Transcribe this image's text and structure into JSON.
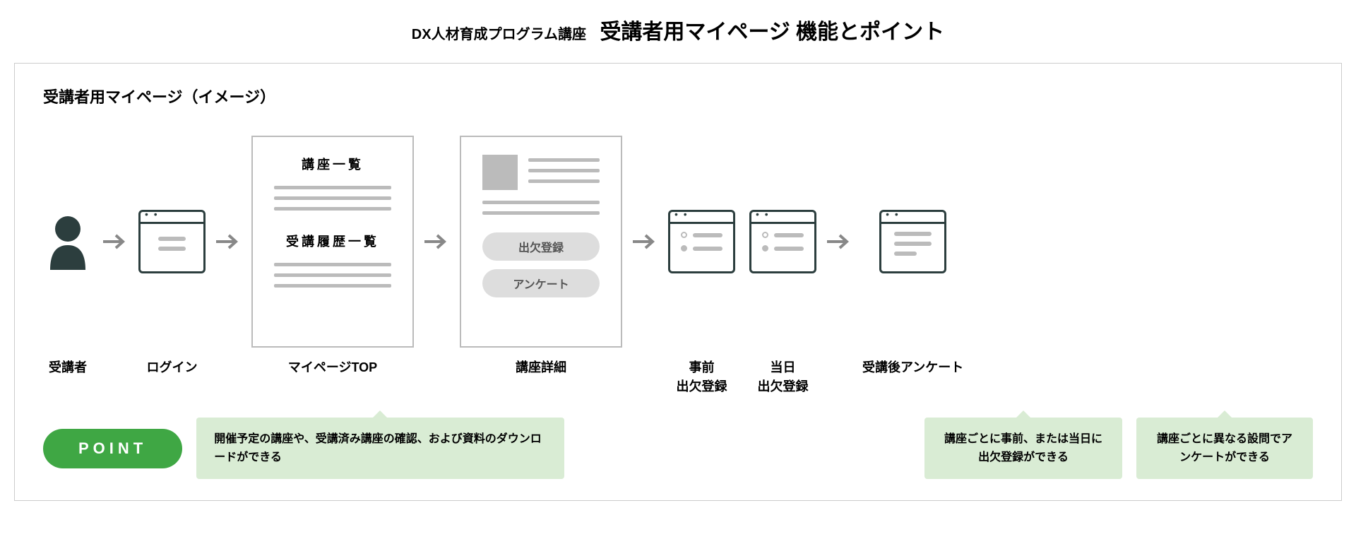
{
  "header": {
    "small": "DX人材育成プログラム講座",
    "large": "受講者用マイページ 機能とポイント"
  },
  "subtitle": "受講者用マイページ（イメージ）",
  "flow": {
    "student": "受講者",
    "login": "ログイン",
    "mypage_top": {
      "label": "マイページTOP",
      "section1": "講座一覧",
      "section2": "受講履歴一覧"
    },
    "course_detail": {
      "label": "講座詳細",
      "pill1": "出欠登録",
      "pill2": "アンケート"
    },
    "attendance_before": "事前\n出欠登録",
    "attendance_day": "当日\n出欠登録",
    "survey": "受講後アンケート"
  },
  "callouts": {
    "point_label": "POINT",
    "c1": "開催予定の講座や、受講済み講座の確認、および資料のダウンロードができる",
    "c2": "講座ごとに事前、または当日に出欠登録ができる",
    "c3": "講座ごとに異なる設問でアンケートができる"
  }
}
